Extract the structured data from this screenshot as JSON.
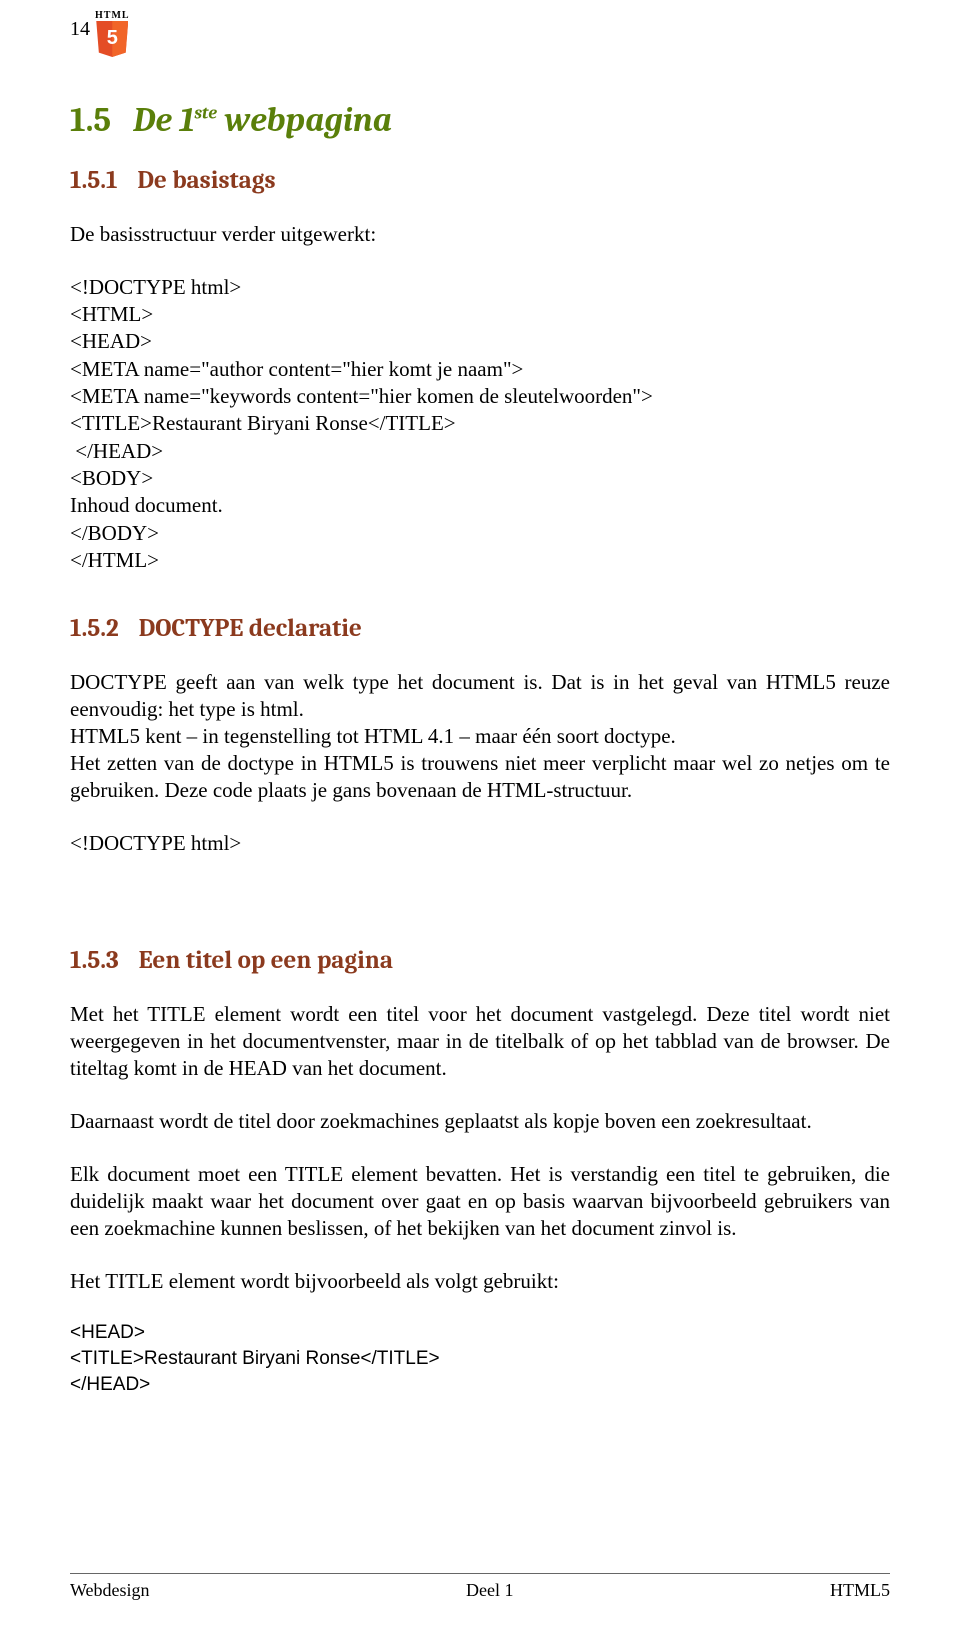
{
  "page_number": "14",
  "badge_label": "HTML",
  "h1": {
    "num": "1.5",
    "pre": "De 1",
    "sup": "ste",
    "post": " webpagina"
  },
  "s1": {
    "num": "1.5.1",
    "title": "De basistags",
    "intro": "De basisstructuur verder uitgewerkt:",
    "code": [
      "<!DOCTYPE html>",
      "<HTML>",
      "<HEAD>",
      "<META name=\"author content=\"hier komt je naam\">",
      "<META name=\"keywords content=\"hier komen de sleutelwoorden\">",
      "<TITLE>Restaurant Biryani Ronse</TITLE>",
      " </HEAD>",
      "<BODY>",
      "Inhoud document.",
      "</BODY>",
      "</HTML>"
    ]
  },
  "s2": {
    "num": "1.5.2",
    "title": "DOCTYPE declaratie",
    "para": "DOCTYPE geeft aan van welk type het document is. Dat is in het geval van HTML5 reuze eenvoudig: het type is html.\nHTML5 kent – in tegenstelling tot HTML 4.1 – maar één soort doctype.\nHet zetten van de doctype in HTML5 is trouwens niet meer verplicht maar wel zo netjes om te gebruiken. Deze code plaats je gans bovenaan de HTML-structuur.",
    "code": "<!DOCTYPE html>"
  },
  "s3": {
    "num": "1.5.3",
    "title": "Een titel op een pagina",
    "p1": "Met het TITLE element wordt een titel voor het document vastgelegd. Deze titel wordt niet weergegeven in het documentvenster, maar in de titelbalk of op het tabblad van de browser. De titeltag komt in de HEAD van het document.",
    "p2": "Daarnaast wordt de titel door zoekmachines geplaatst als kopje boven een zoekresultaat.",
    "p3": "Elk document moet een TITLE element bevatten. Het is verstandig een titel te gebruiken, die duidelijk maakt waar het document over gaat en op basis waarvan bijvoorbeeld gebruikers van een zoekmachine kunnen beslissen, of het bekijken van het document zinvol is.",
    "p4": "Het TITLE element wordt bijvoorbeeld als volgt gebruikt:",
    "code": [
      "<HEAD>",
      "<TITLE>Restaurant Biryani Ronse</TITLE>",
      "</HEAD>"
    ]
  },
  "footer": {
    "left": "Webdesign",
    "center": "Deel 1",
    "right": "HTML5"
  }
}
